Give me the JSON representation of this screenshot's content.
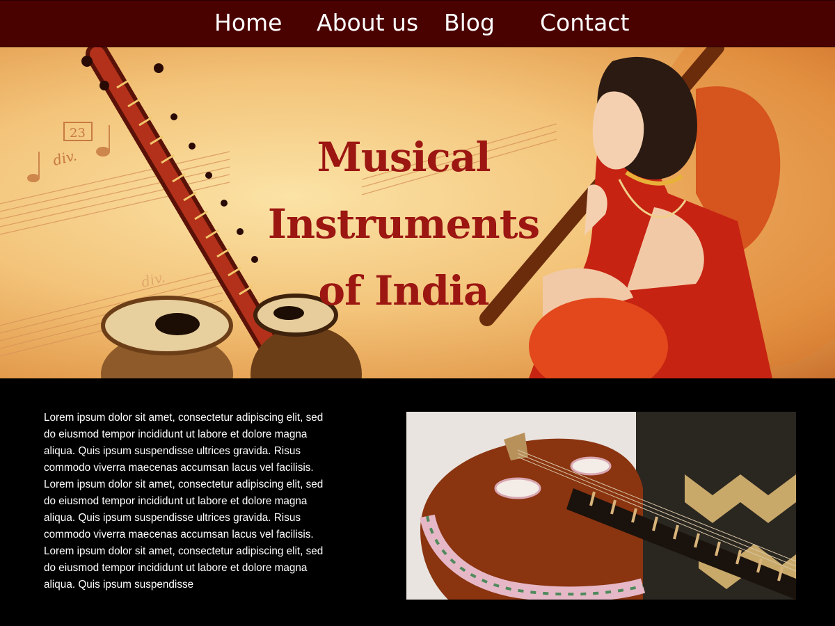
{
  "nav": {
    "items": [
      {
        "label": "Home"
      },
      {
        "label": "About us"
      },
      {
        "label": "Blog"
      },
      {
        "label": "Contact"
      }
    ]
  },
  "hero": {
    "title_line1": "Musical Instruments",
    "title_line2": "of India",
    "sheet_number": "23",
    "sheet_marking": "div."
  },
  "content": {
    "paragraph": "Lorem ipsum dolor sit amet, consectetur adipiscing elit, sed do eiusmod tempor incididunt ut labore et dolore magna aliqua. Quis ipsum suspendisse ultrices gravida. Risus commodo viverra maecenas accumsan lacus vel facilisis. Lorem ipsum dolor sit amet, consectetur adipiscing elit, sed do eiusmod tempor incididunt ut labore et dolore magna aliqua. Quis ipsum suspendisse ultrices gravida. Risus commodo viverra maecenas accumsan lacus vel facilisis. Lorem ipsum dolor sit amet, consectetur adipiscing elit, sed do eiusmod tempor incididunt ut labore et dolore magna aliqua. Quis ipsum suspendisse"
  },
  "colors": {
    "nav_bg": "#4a0201",
    "title": "#9c1612",
    "page_bg": "#000000"
  }
}
